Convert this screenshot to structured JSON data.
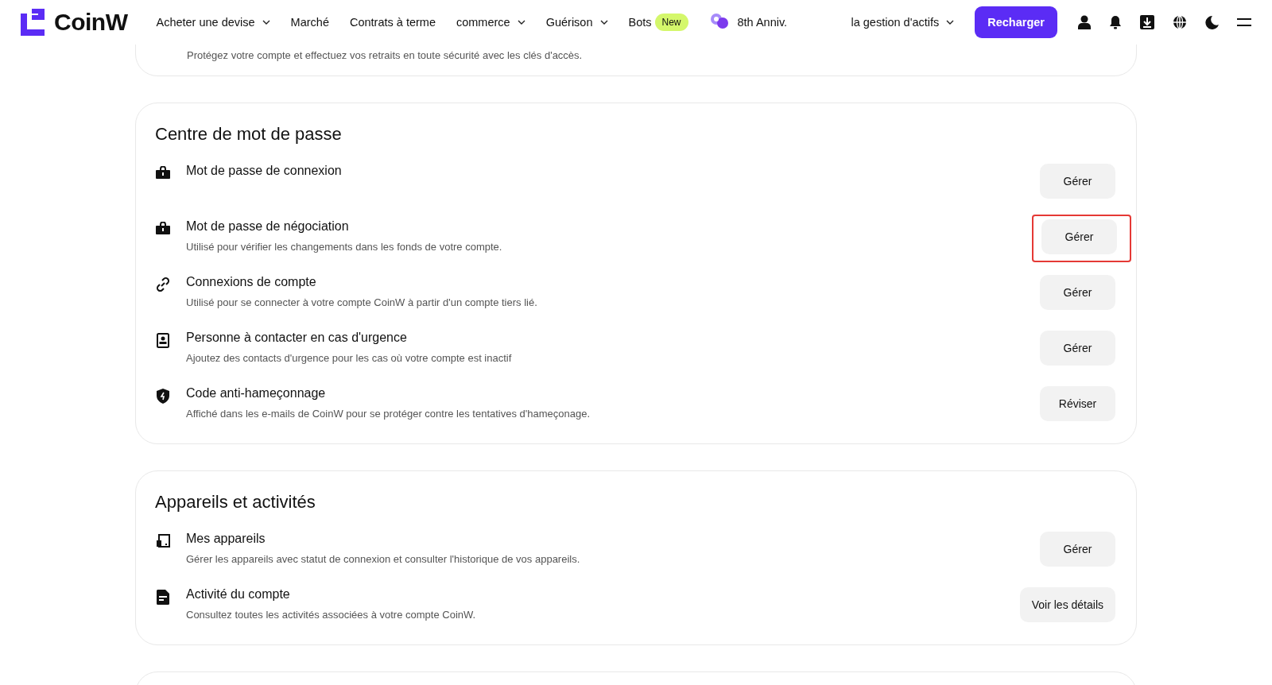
{
  "header": {
    "logo": "CoinW",
    "nav": [
      {
        "label": "Acheter une devise",
        "dropdown": true
      },
      {
        "label": "Marché",
        "dropdown": false
      },
      {
        "label": "Contrats à terme",
        "dropdown": false
      },
      {
        "label": "commerce",
        "dropdown": true
      },
      {
        "label": "Guérison",
        "dropdown": true
      },
      {
        "label": "Bots",
        "dropdown": false,
        "badge": "New"
      },
      {
        "label": "8th Anniv.",
        "dropdown": false,
        "kind": "anniv"
      }
    ],
    "assets": "la gestion d'actifs",
    "deposit": "Recharger"
  },
  "top_card": {
    "description": "Protégez votre compte et effectuez vos retraits en toute sécurité avec les clés d'accès."
  },
  "sections": [
    {
      "title": "Centre de mot de passe",
      "items": [
        {
          "kind": "lock",
          "title": "Mot de passe de connexion",
          "button": "Gérer",
          "highlighted": false
        },
        {
          "kind": "lock",
          "title": "Mot de passe de négociation",
          "description": "Utilisé pour vérifier les changements dans les fonds de votre compte.",
          "button": "Gérer",
          "highlighted": true
        },
        {
          "kind": "link",
          "title": "Connexions de compte",
          "description": "Utilisé pour se connecter à votre compte CoinW à partir d'un compte tiers lié.",
          "button": "Gérer",
          "highlighted": false
        },
        {
          "kind": "contact",
          "title": "Personne à contacter en cas d'urgence",
          "description": "Ajoutez des contacts d'urgence pour les cas où votre compte est inactif",
          "button": "Gérer",
          "highlighted": false
        },
        {
          "kind": "shield",
          "title": "Code anti-hameçonnage",
          "description": "Affiché dans les e-mails de CoinW pour se protéger contre les tentatives d'hameçonage.",
          "button": "Réviser",
          "highlighted": false
        }
      ]
    },
    {
      "title": "Appareils et activités",
      "items": [
        {
          "kind": "device",
          "title": "Mes appareils",
          "description": "Gérer les appareils avec statut de connexion et consulter l'historique de vos appareils.",
          "button": "Gérer",
          "highlighted": false
        },
        {
          "kind": "doc",
          "title": "Activité du compte",
          "description": "Consultez toutes les activités associées à votre compte CoinW.",
          "button": "Voir les détails",
          "highlighted": false
        }
      ]
    }
  ]
}
